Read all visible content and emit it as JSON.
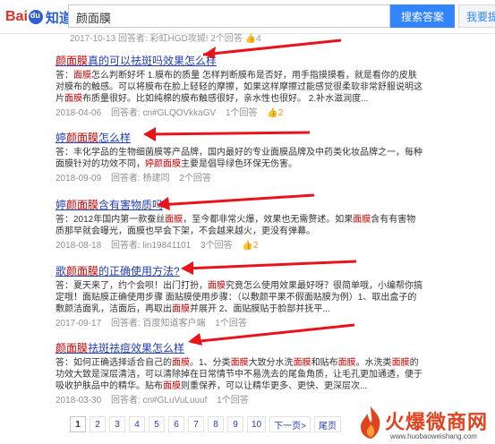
{
  "header": {
    "logo_bai": "Bai",
    "logo_du": "du",
    "logo_zhidao": "知道",
    "search_value": "颜面膜",
    "search_button": "搜索答案",
    "ask_button": "我要提问"
  },
  "top_meta": {
    "date": "2017-10-13",
    "answerer": "回答者: 彩虹HGD攻城!",
    "count": "2个回答",
    "likes": "4"
  },
  "results": [
    {
      "title_pre": "",
      "title_em": "颜面膜",
      "title_post": "真的可以祛斑吗效果怎么样",
      "snippet": [
        {
          "t": "答：",
          "e": false
        },
        {
          "t": "面膜",
          "e": true
        },
        {
          "t": "怎么判断好坏 1.膜布的质量 怎样判断膜布是否好，用手指摸摸看，就是看你的皮肤对膜布的触感。可以将膜布在脸上轻轻的摩擦，如果这样摩擦过能感觉很柔软非常舒服说明这片",
          "e": false
        },
        {
          "t": "面膜",
          "e": true
        },
        {
          "t": "布质量很好。比如纯棉的膜布触感很好，亲水性也很好。 2.补水滋润度...",
          "e": false
        }
      ],
      "date": "2018-04-06",
      "answerer": "回答者: cn#GLQOVkkaGV",
      "count": "1个回答",
      "likes": "2"
    },
    {
      "title_pre": "婷",
      "title_em": "颜面膜",
      "title_post": "怎么样",
      "snippet": [
        {
          "t": "答：丰化学品的生物细菌膜等产品牌，国内最好的专业面膜品牌及中药类化妆品牌之一，每种面膜针对的功效不同，",
          "e": false
        },
        {
          "t": "婷颜面膜",
          "e": true
        },
        {
          "t": "主要是倡导绿色环保无伤害。",
          "e": false
        }
      ],
      "date": "2018-09-09",
      "answerer": "回答者: 杨建同",
      "count": "2个回答",
      "likes": ""
    },
    {
      "title_pre": "婷",
      "title_em": "颜面膜",
      "title_post": "含有害物质吗",
      "snippet": [
        {
          "t": "答：2012年国内第一款蚕丝",
          "e": false
        },
        {
          "t": "面膜",
          "e": true
        },
        {
          "t": "，至今都非常火爆，效果也无需赘述。如果",
          "e": false
        },
        {
          "t": "面膜",
          "e": true
        },
        {
          "t": "含有有害物质那早就会曝光，面膜也早会下架，不会越来越火，更没有弹幕。",
          "e": false
        }
      ],
      "date": "2018-08-18",
      "answerer": "回答者: lin19841101",
      "count": "3个回答",
      "likes": "2"
    },
    {
      "title_pre": "歌",
      "title_em": "颜面膜",
      "title_post": "的正确使用方法?",
      "snippet": [
        {
          "t": "答：夏天来了，约个会呗！出门打扮，",
          "e": false
        },
        {
          "t": "面膜",
          "e": true
        },
        {
          "t": "究竟怎么使用效果最好呀？很简单哦，小编帮你搞定哦！面贴膜正确使用步骤 面贴膜使用步骤：（以敷颜平果不假面贴膜为例）1、取出盒子的敷颜洁面乳，洁面后，再取出",
          "e": false
        },
        {
          "t": "面膜",
          "e": true
        },
        {
          "t": "并展开 2、面贴膜贴于脸部并抚平...",
          "e": false
        }
      ],
      "date": "2017-09-17",
      "answerer": "回答者: 百度知道客户端",
      "count": "1个回答",
      "likes": ""
    },
    {
      "title_pre": "",
      "title_em": "颜面膜",
      "title_post": "祛斑祛痘效果怎么样",
      "snippet": [
        {
          "t": "答：如何正确选择适合自己的",
          "e": false
        },
        {
          "t": "面膜",
          "e": true
        },
        {
          "t": "。1、分类",
          "e": false
        },
        {
          "t": "面膜",
          "e": true
        },
        {
          "t": "大致分水洗",
          "e": false
        },
        {
          "t": "面膜",
          "e": true
        },
        {
          "t": "和贴布",
          "e": false
        },
        {
          "t": "面膜",
          "e": true
        },
        {
          "t": "。水洗类",
          "e": false
        },
        {
          "t": "面膜",
          "e": true
        },
        {
          "t": "的功效大致是深层清洁，可以清除掉在日常情节中不易洗去的尾鱼角质，让毛孔更加通透，便于吸收护肤品中的精华。贴布",
          "e": false
        },
        {
          "t": "面膜",
          "e": true
        },
        {
          "t": "则重保养，可以让精华更多、更快、更深层次...",
          "e": false
        }
      ],
      "date": "2018-03-30",
      "answerer": "回答者: cn#GLuVuLuuuf",
      "count": "1个回答",
      "likes": ""
    }
  ],
  "pagination": {
    "pages": [
      "1",
      "2",
      "3",
      "4",
      "5",
      "6",
      "7",
      "8",
      "9",
      "10"
    ],
    "next": "下一页>",
    "last": "尾页"
  },
  "watermark": {
    "text": "火爆微商网",
    "url": "www.huobaoweishang.com"
  },
  "colors": {
    "link": "#2440b3",
    "highlight": "#cc0000",
    "arrow": "#e8141b",
    "search_button": "#3385ff",
    "brand_red": "#de2f28",
    "brand_blue": "#2d5fd1"
  }
}
